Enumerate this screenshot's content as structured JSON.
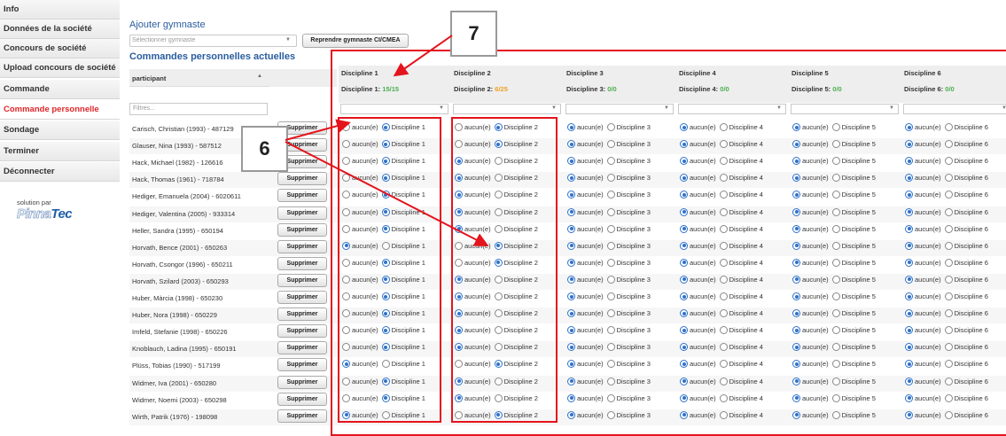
{
  "sidebar": {
    "items": [
      {
        "label": "Info",
        "active": false
      },
      {
        "label": "Données de la société",
        "active": false
      },
      {
        "label": "Concours de société",
        "active": false
      },
      {
        "label": "Upload concours de société",
        "active": false
      },
      {
        "label": "Commande",
        "active": false
      },
      {
        "label": "Commande personnelle",
        "active": true
      },
      {
        "label": "Sondage",
        "active": false
      },
      {
        "label": "Terminer",
        "active": false
      },
      {
        "label": "Déconnecter",
        "active": false
      }
    ],
    "solution_label": "solution par",
    "logo": {
      "part1": "Pinna",
      "part2": "Tec"
    }
  },
  "add_gymnast": {
    "title": "Ajouter gymnaste",
    "select_placeholder": "Sélectionner gymnaste",
    "resume_button": "Reprendre gymnaste CI/CMEA"
  },
  "orders": {
    "title": "Commandes personnelles actuelles",
    "participant_header": "participant",
    "filter_placeholder": "Filtres...",
    "delete_label": "Supprimer",
    "none_label": "aucun(e)",
    "disciplines": [
      {
        "name": "Discipline 1",
        "count_label": "Discipline 1:",
        "count": "15/15",
        "status": "ok"
      },
      {
        "name": "Discipline 2",
        "count_label": "Discipline 2:",
        "count": "6/25",
        "status": "warn"
      },
      {
        "name": "Discipline 3",
        "count_label": "Discipline 3:",
        "count": "0/0",
        "status": "ok"
      },
      {
        "name": "Discipline 4",
        "count_label": "Discipline 4:",
        "count": "0/0",
        "status": "ok"
      },
      {
        "name": "Discipline 5",
        "count_label": "Discipline 5:",
        "count": "0/0",
        "status": "ok"
      },
      {
        "name": "Discipline 6",
        "count_label": "Discipline 6:",
        "count": "0/0",
        "status": "ok"
      }
    ],
    "rows": [
      {
        "participant": "Carisch, Christian (1993) - 487129",
        "selected": [
          1,
          1,
          0,
          0,
          0,
          0
        ]
      },
      {
        "participant": "Glauser, Nina (1993) - 587512",
        "selected": [
          1,
          1,
          0,
          0,
          0,
          0
        ]
      },
      {
        "participant": "Hack, Michael (1982) - 126616",
        "selected": [
          1,
          0,
          0,
          0,
          0,
          0
        ]
      },
      {
        "participant": "Hack, Thomas (1961) - 718784",
        "selected": [
          1,
          0,
          0,
          0,
          0,
          0
        ]
      },
      {
        "participant": "Hediger, Emanuela (2004) - 6020611",
        "selected": [
          1,
          0,
          0,
          0,
          0,
          0
        ]
      },
      {
        "participant": "Hediger, Valentina (2005) - 933314",
        "selected": [
          1,
          0,
          0,
          0,
          0,
          0
        ]
      },
      {
        "participant": "Heller, Sandra (1995) - 650194",
        "selected": [
          1,
          0,
          0,
          0,
          0,
          0
        ]
      },
      {
        "participant": "Horvath, Bence (2001) - 650263",
        "selected": [
          0,
          1,
          0,
          0,
          0,
          0
        ]
      },
      {
        "participant": "Horvath, Csongor (1996) - 650211",
        "selected": [
          1,
          1,
          0,
          0,
          0,
          0
        ]
      },
      {
        "participant": "Horvath, Szilard (2003) - 650293",
        "selected": [
          1,
          0,
          0,
          0,
          0,
          0
        ]
      },
      {
        "participant": "Huber, Màrcia (1998) - 650230",
        "selected": [
          1,
          0,
          0,
          0,
          0,
          0
        ]
      },
      {
        "participant": "Huber, Nora (1998) - 650229",
        "selected": [
          1,
          0,
          0,
          0,
          0,
          0
        ]
      },
      {
        "participant": "Imfeld, Stefanie (1998) - 650226",
        "selected": [
          1,
          0,
          0,
          0,
          0,
          0
        ]
      },
      {
        "participant": "Knoblauch, Ladina (1995) - 650191",
        "selected": [
          1,
          0,
          0,
          0,
          0,
          0
        ]
      },
      {
        "participant": "Plüss, Tobias (1990) - 517199",
        "selected": [
          0,
          1,
          0,
          0,
          0,
          0
        ]
      },
      {
        "participant": "Widmer, Iva (2001) - 650280",
        "selected": [
          1,
          0,
          0,
          0,
          0,
          0
        ]
      },
      {
        "participant": "Widmer, Noemi (2003) - 650298",
        "selected": [
          1,
          0,
          0,
          0,
          0,
          0
        ]
      },
      {
        "participant": "Wirth, Patrik (1976) - 198098",
        "selected": [
          0,
          1,
          0,
          0,
          0,
          0
        ]
      }
    ]
  },
  "annotations": {
    "callout_6": "6",
    "callout_7": "7",
    "annotation_color": "#e4141c"
  },
  "colors": {
    "accent_blue": "#2a5d9f",
    "active_nav": "#e0262a",
    "count_ok": "#4caf50",
    "count_warn": "#f0a020"
  }
}
